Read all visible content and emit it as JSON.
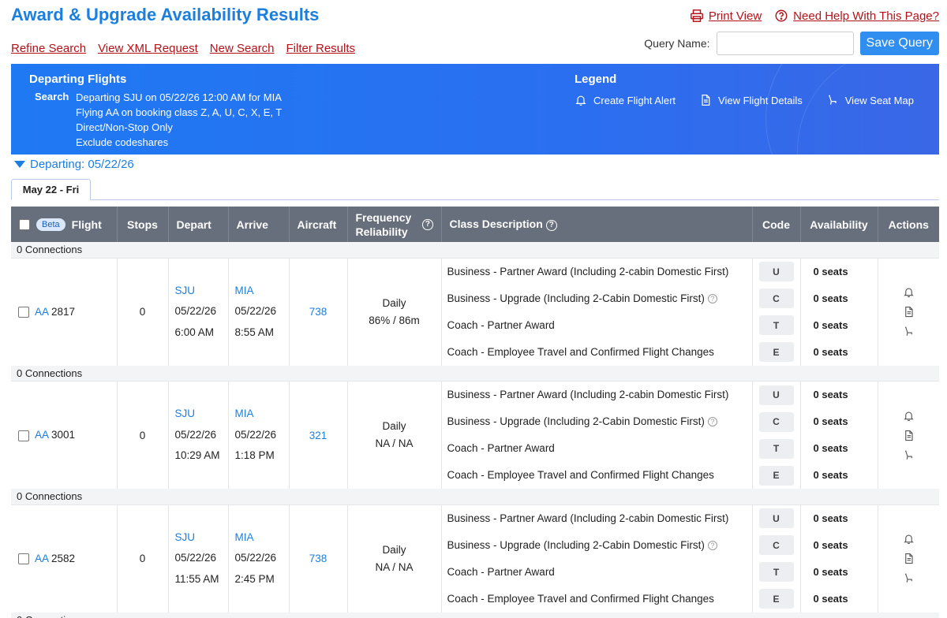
{
  "page": {
    "title": "Award & Upgrade Availability Results",
    "print_view": "Print View",
    "need_help": "Need Help With This Page?"
  },
  "nav": {
    "refine_search": "Refine Search",
    "view_xml": "View XML Request",
    "new_search": "New Search",
    "filter_results": "Filter Results"
  },
  "query": {
    "label": "Query Name:",
    "value": "",
    "save_label": "Save Query"
  },
  "banner": {
    "title": "Departing Flights",
    "search_label": "Search",
    "search_lines": [
      "Departing SJU on 05/22/26 12:00 AM for MIA",
      "Flying AA on booking class Z, A, U, C, X, E, T",
      "Direct/Non-Stop Only",
      "Exclude codeshares"
    ],
    "legend_title": "Legend",
    "legend": {
      "alert": "Create Flight Alert",
      "details": "View Flight Details",
      "seatmap": "View Seat Map"
    }
  },
  "departing_label": "Departing: 05/22/26",
  "tab_label": "May 22 - Fri",
  "table": {
    "headers": {
      "beta": "Beta",
      "flight": "Flight",
      "stops": "Stops",
      "depart": "Depart",
      "arrive": "Arrive",
      "aircraft": "Aircraft",
      "freq1": "Frequency",
      "freq2": "Reliability",
      "class": "Class Description",
      "code": "Code",
      "availability": "Availability",
      "actions": "Actions"
    },
    "connection_label": "0 Connections",
    "classes": [
      {
        "desc": "Business - Partner Award (Including 2-cabin Domestic First)",
        "code": "U",
        "help": false
      },
      {
        "desc": "Business - Upgrade (Including 2-Cabin Domestic First)",
        "code": "C",
        "help": true
      },
      {
        "desc": "Coach - Partner Award",
        "code": "T",
        "help": false
      },
      {
        "desc": "Coach - Employee Travel and Confirmed Flight Changes",
        "code": "E",
        "help": false
      }
    ],
    "flights": [
      {
        "carrier": "AA",
        "number": "2817",
        "stops": "0",
        "dep_airport": "SJU",
        "dep_date": "05/22/26",
        "dep_time": "6:00 AM",
        "arr_airport": "MIA",
        "arr_date": "05/22/26",
        "arr_time": "8:55 AM",
        "aircraft": "738",
        "frequency": "Daily",
        "reliability": "86% / 86m",
        "seats": [
          "0 seats",
          "0 seats",
          "0 seats",
          "0 seats"
        ]
      },
      {
        "carrier": "AA",
        "number": "3001",
        "stops": "0",
        "dep_airport": "SJU",
        "dep_date": "05/22/26",
        "dep_time": "10:29 AM",
        "arr_airport": "MIA",
        "arr_date": "05/22/26",
        "arr_time": "1:18 PM",
        "aircraft": "321",
        "frequency": "Daily",
        "reliability": "NA / NA",
        "seats": [
          "0 seats",
          "0 seats",
          "0 seats",
          "0 seats"
        ]
      },
      {
        "carrier": "AA",
        "number": "2582",
        "stops": "0",
        "dep_airport": "SJU",
        "dep_date": "05/22/26",
        "dep_time": "11:55 AM",
        "arr_airport": "MIA",
        "arr_date": "05/22/26",
        "arr_time": "2:45 PM",
        "aircraft": "738",
        "frequency": "Daily",
        "reliability": "NA / NA",
        "seats": [
          "0 seats",
          "0 seats",
          "0 seats",
          "0 seats"
        ]
      }
    ]
  }
}
